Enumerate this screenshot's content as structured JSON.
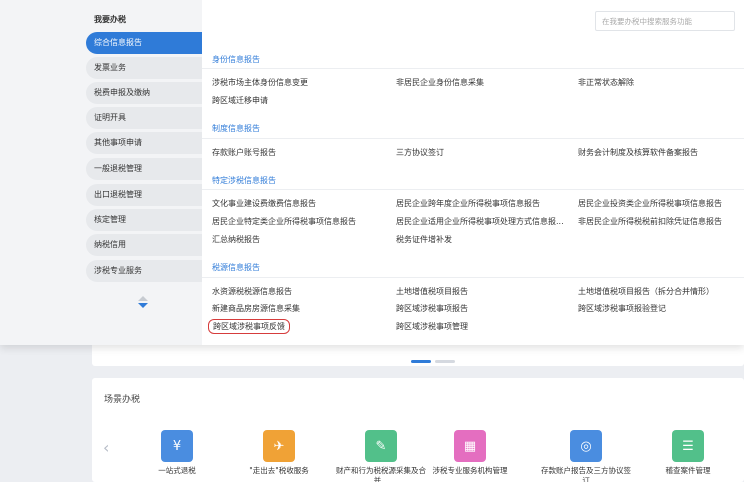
{
  "sidebar": {
    "title": "我要办税",
    "items": [
      {
        "label": "综合信息报告"
      },
      {
        "label": "发票业务"
      },
      {
        "label": "税费申报及缴纳"
      },
      {
        "label": "证明开具"
      },
      {
        "label": "其他事项申请"
      },
      {
        "label": "一般退税管理"
      },
      {
        "label": "出口退税管理"
      },
      {
        "label": "核定管理"
      },
      {
        "label": "纳税信用"
      },
      {
        "label": "涉税专业服务"
      }
    ]
  },
  "search": {
    "placeholder": "在我要办税中搜索服务功能"
  },
  "sections": [
    {
      "title": "身份信息报告",
      "links": [
        "涉税市场主体身份信息变更",
        "非居民企业身份信息采集",
        "非正常状态解除",
        "跨区域迁移申请"
      ]
    },
    {
      "title": "制度信息报告",
      "links": [
        "存款账户账号报告",
        "三方协议签订",
        "财务会计制度及核算软件备案报告"
      ]
    },
    {
      "title": "特定涉税信息报告",
      "links": [
        "文化事业建设费缴费信息报告",
        "居民企业跨年度企业所得税事项信息报告",
        "居民企业投资类企业所得税事项信息报告",
        "居民企业特定类企业所得税事项信息报告",
        "居民企业适用企业所得税事项处理方式信息报...",
        "非居民企业所得税税前扣除凭证信息报告",
        "汇总纳税报告",
        "税务证件增补发"
      ]
    },
    {
      "title": "税源信息报告",
      "links": [
        "水资源税税源信息报告",
        "土地增值税项目报告",
        "土地增值税项目报告（拆分合并情形）",
        "新建商品房房源信息采集",
        "跨区域涉税事项报告",
        "跨区域涉税事项报验登记",
        "跨区域涉税事项反馈",
        "跨区域涉税事项管理"
      ]
    }
  ],
  "scene": {
    "title": "场景办税",
    "items": [
      {
        "label": "一站式退税",
        "icon": "refund-icon",
        "color": "#4a8de0"
      },
      {
        "label": "\"走出去\"税收服务",
        "icon": "go-global-icon",
        "color": "#f0a236"
      },
      {
        "label": "财产和行为税税源采集及合并...",
        "icon": "property-tax-icon",
        "color": "#52c08a"
      },
      {
        "label": "涉税专业服务机构管理",
        "icon": "agency-icon",
        "color": "#e46ec0"
      },
      {
        "label": "存款账户报告及三方协议签订",
        "icon": "bank-account-icon",
        "color": "#4a8de0"
      },
      {
        "label": "稽查案件管理",
        "icon": "audit-case-icon",
        "color": "#52c08a"
      }
    ]
  },
  "colors": {
    "accent": "#2f7bd8",
    "highlight": "#d63c3c"
  }
}
